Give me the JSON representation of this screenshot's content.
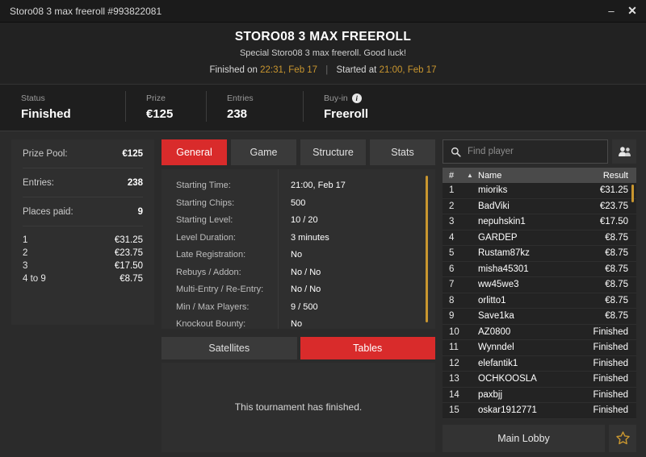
{
  "window": {
    "title": "Storo08 3 max freeroll #993822081",
    "minimize_label": "–",
    "close_label": "✕"
  },
  "header": {
    "title": "STORO08 3 MAX FREEROLL",
    "subtitle": "Special Storo08 3 max freeroll. Good luck!",
    "finished_prefix": "Finished on",
    "finished_time": "22:31, Feb 17",
    "separator": "|",
    "started_prefix": "Started at",
    "started_time": "21:00, Feb 17",
    "accent_gold": "#c9962f"
  },
  "stats": [
    {
      "label": "Status",
      "value": "Finished",
      "info": false
    },
    {
      "label": "Prize",
      "value": "€125",
      "info": false
    },
    {
      "label": "Entries",
      "value": "238",
      "info": false
    },
    {
      "label": "Buy-in",
      "value": "Freeroll",
      "info": true,
      "info_glyph": "i"
    }
  ],
  "prize_panel": {
    "rows": [
      {
        "key": "Prize Pool:",
        "value": "€125"
      },
      {
        "key": "Entries:",
        "value": "238"
      },
      {
        "key": "Places paid:",
        "value": "9"
      }
    ],
    "payouts": [
      {
        "place": "1",
        "amount": "€31.25"
      },
      {
        "place": "2",
        "amount": "€23.75"
      },
      {
        "place": "3",
        "amount": "€17.50"
      },
      {
        "place": "4  to  9",
        "amount": "€8.75"
      }
    ]
  },
  "tabs": [
    {
      "label": "General",
      "active": true
    },
    {
      "label": "Game",
      "active": false
    },
    {
      "label": "Structure",
      "active": false
    },
    {
      "label": "Stats",
      "active": false
    }
  ],
  "details": [
    {
      "label": "Starting Time:",
      "value": "21:00, Feb 17"
    },
    {
      "label": "Starting Chips:",
      "value": "500"
    },
    {
      "label": "Starting Level:",
      "value": "10 / 20"
    },
    {
      "label": "Level Duration:",
      "value": "3 minutes"
    },
    {
      "label": "Late Registration:",
      "value": "No"
    },
    {
      "label": "Rebuys / Addon:",
      "value": "No / No"
    },
    {
      "label": "Multi-Entry / Re-Entry:",
      "value": "No / No"
    },
    {
      "label": "Min / Max Players:",
      "value": "9 / 500"
    },
    {
      "label": "Knockout Bounty:",
      "value": "No"
    }
  ],
  "segments": [
    {
      "label": "Satellites",
      "active": false
    },
    {
      "label": "Tables",
      "active": true
    }
  ],
  "finished_message": "This tournament has finished.",
  "search": {
    "placeholder": "Find player",
    "value": "",
    "search_icon": "search-icon",
    "players_icon": "players-icon"
  },
  "player_table": {
    "columns": {
      "num": "#",
      "sort": "▲",
      "name": "Name",
      "result": "Result"
    },
    "rows": [
      {
        "num": "1",
        "name": "mioriks",
        "result": "€31.25"
      },
      {
        "num": "2",
        "name": "BadViki",
        "result": "€23.75"
      },
      {
        "num": "3",
        "name": "nepuhskin1",
        "result": "€17.50"
      },
      {
        "num": "4",
        "name": "GARDEP",
        "result": "€8.75"
      },
      {
        "num": "5",
        "name": "Rustam87kz",
        "result": "€8.75"
      },
      {
        "num": "6",
        "name": "misha45301",
        "result": "€8.75"
      },
      {
        "num": "7",
        "name": "ww45we3",
        "result": "€8.75"
      },
      {
        "num": "8",
        "name": "orlitto1",
        "result": "€8.75"
      },
      {
        "num": "9",
        "name": "Save1ka",
        "result": "€8.75"
      },
      {
        "num": "10",
        "name": "AZ0800",
        "result": "Finished"
      },
      {
        "num": "11",
        "name": "Wynndel",
        "result": "Finished"
      },
      {
        "num": "12",
        "name": "elefantik1",
        "result": "Finished"
      },
      {
        "num": "13",
        "name": "OCHKOOSLA",
        "result": "Finished"
      },
      {
        "num": "14",
        "name": "paxbjj",
        "result": "Finished"
      },
      {
        "num": "15",
        "name": "oskar1912771",
        "result": "Finished"
      }
    ]
  },
  "footer": {
    "main_lobby_label": "Main Lobby",
    "favorite_icon": "star-icon"
  }
}
